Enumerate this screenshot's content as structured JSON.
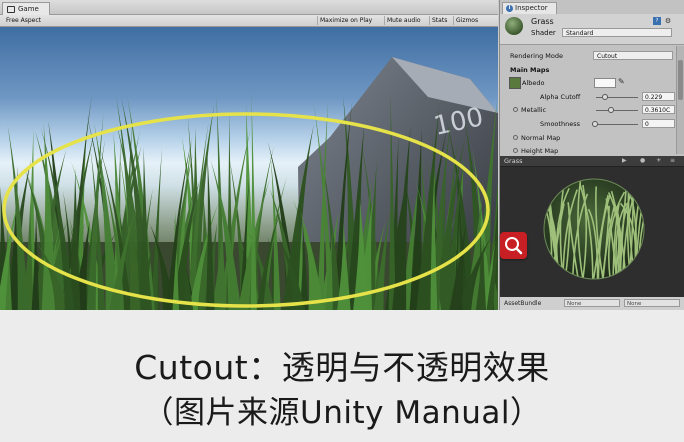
{
  "game_panel": {
    "tab_label": "Game",
    "aspect_dropdown": "Free Aspect",
    "toolbar_buttons": [
      "Maximize on Play",
      "Mute audio",
      "Stats",
      "Gizmos"
    ],
    "highlight_color": "#e6e24a"
  },
  "inspector": {
    "tab_label": "Inspector",
    "material_name": "Grass",
    "shader_label": "Shader",
    "shader_value": "Standard",
    "rendering_mode_label": "Rendering Mode",
    "rendering_mode_value": "Cutout",
    "main_maps_label": "Main Maps",
    "albedo_label": "Albedo",
    "alpha_cutoff_label": "Alpha Cutoff",
    "alpha_cutoff_value": "0.229",
    "metallic_label": "Metallic",
    "metallic_value": "0.3610C",
    "smoothness_label": "Smoothness",
    "smoothness_value": "0",
    "normal_map_label": "Normal Map",
    "height_map_label": "Height Map",
    "preview_title": "Grass",
    "assetbundle_label": "AssetBundle",
    "assetbundle_value": "None",
    "assetbundle_variant": "None"
  },
  "caption": {
    "line1": "Cutout：透明与不透明效果",
    "line2": "（图片来源Unity Manual）"
  },
  "colors": {
    "search_button": "#c71f23"
  }
}
